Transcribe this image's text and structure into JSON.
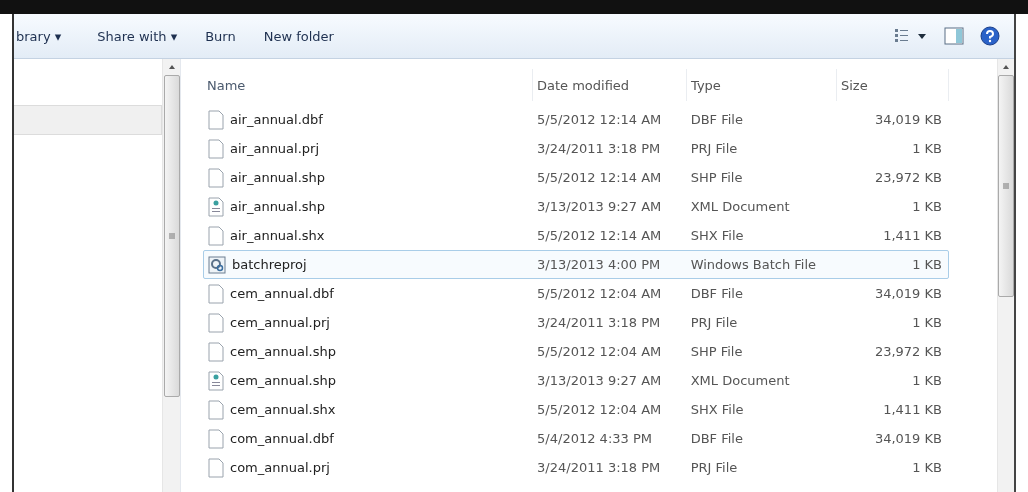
{
  "toolbar": {
    "items": [
      {
        "label": "brary ▾"
      },
      {
        "label": "Share with ▾"
      },
      {
        "label": "Burn"
      },
      {
        "label": "New folder"
      }
    ]
  },
  "table": {
    "columns": [
      "Name",
      "Date modified",
      "Type",
      "Size"
    ],
    "rows": [
      {
        "kind": "blank",
        "name": "air_annual.dbf",
        "date": "5/5/2012 12:14 AM",
        "type": "DBF File",
        "size": "34,019 KB",
        "selected": false
      },
      {
        "kind": "blank",
        "name": "air_annual.prj",
        "date": "3/24/2011 3:18 PM",
        "type": "PRJ File",
        "size": "1 KB",
        "selected": false
      },
      {
        "kind": "blank",
        "name": "air_annual.shp",
        "date": "5/5/2012 12:14 AM",
        "type": "SHP File",
        "size": "23,972 KB",
        "selected": false
      },
      {
        "kind": "xml",
        "name": "air_annual.shp",
        "date": "3/13/2013 9:27 AM",
        "type": "XML Document",
        "size": "1 KB",
        "selected": false
      },
      {
        "kind": "blank",
        "name": "air_annual.shx",
        "date": "5/5/2012 12:14 AM",
        "type": "SHX File",
        "size": "1,411 KB",
        "selected": false
      },
      {
        "kind": "batch",
        "name": "batchreproj",
        "date": "3/13/2013 4:00 PM",
        "type": "Windows Batch File",
        "size": "1 KB",
        "selected": true
      },
      {
        "kind": "blank",
        "name": "cem_annual.dbf",
        "date": "5/5/2012 12:04 AM",
        "type": "DBF File",
        "size": "34,019 KB",
        "selected": false
      },
      {
        "kind": "blank",
        "name": "cem_annual.prj",
        "date": "3/24/2011 3:18 PM",
        "type": "PRJ File",
        "size": "1 KB",
        "selected": false
      },
      {
        "kind": "blank",
        "name": "cem_annual.shp",
        "date": "5/5/2012 12:04 AM",
        "type": "SHP File",
        "size": "23,972 KB",
        "selected": false
      },
      {
        "kind": "xml",
        "name": "cem_annual.shp",
        "date": "3/13/2013 9:27 AM",
        "type": "XML Document",
        "size": "1 KB",
        "selected": false
      },
      {
        "kind": "blank",
        "name": "cem_annual.shx",
        "date": "5/5/2012 12:04 AM",
        "type": "SHX File",
        "size": "1,411 KB",
        "selected": false
      },
      {
        "kind": "blank",
        "name": "com_annual.dbf",
        "date": "5/4/2012 4:33 PM",
        "type": "DBF File",
        "size": "34,019 KB",
        "selected": false
      },
      {
        "kind": "blank",
        "name": "com_annual.prj",
        "date": "3/24/2011 3:18 PM",
        "type": "PRJ File",
        "size": "1 KB",
        "selected": false
      }
    ]
  }
}
